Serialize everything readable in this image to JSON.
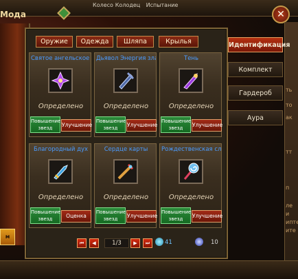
{
  "window": {
    "title": "Мода",
    "close": "✕"
  },
  "top_tabs": [
    "Колесо",
    "Колодец",
    "Испытание"
  ],
  "category_tabs": [
    {
      "label": "Оружие"
    },
    {
      "label": "Одежда"
    },
    {
      "label": "Шляпа"
    },
    {
      "label": "Крылья"
    }
  ],
  "side_menu": [
    {
      "label": "Идентификация",
      "active": true
    },
    {
      "label": "Комплект",
      "active": false
    },
    {
      "label": "Гардероб",
      "active": false
    },
    {
      "label": "Аура",
      "active": false
    }
  ],
  "side_texts": [
    "ть",
    "то",
    "ак",
    "тт",
    "п",
    "ле",
    "и",
    "ипте",
    "ите"
  ],
  "items": [
    {
      "name": "Святое ангельское ор",
      "status": "Определено",
      "btn1": "Повышение звезд",
      "btn2": "Улучшение",
      "icon": "purple-angel-weapon-icon",
      "color": "#b44cf0"
    },
    {
      "name": "Дьявол Энергия зла",
      "status": "Определено",
      "btn1": "Повышение звезд",
      "btn2": "Улучшение",
      "icon": "dark-devil-weapon-icon",
      "color": "#4f6aa8"
    },
    {
      "name": "Тень",
      "status": "Определено",
      "btn1": "Повышение звезд",
      "btn2": "Улучшение",
      "icon": "shadow-weapon-icon",
      "color": "#9a3ae0"
    },
    {
      "name": "Благородный дух",
      "status": "Определено",
      "btn1": "Повышение звезд",
      "btn2": "Оценка",
      "icon": "noble-spirit-weapon-icon",
      "color": "#3aa0e0"
    },
    {
      "name": "Сердце карты",
      "status": "Определено",
      "btn1": "Повышение звезд",
      "btn2": "Улучшение",
      "icon": "card-heart-weapon-icon",
      "color": "#e0a040"
    },
    {
      "name": "Рождественская слад",
      "status": "Определено",
      "btn1": "Повышение звезд",
      "btn2": "Улучшение",
      "icon": "christmas-candy-weapon-icon",
      "color": "#e04060"
    }
  ],
  "pager": {
    "page": "1/3",
    "first": "⏮",
    "prev": "◀",
    "next": "▶",
    "last": "⏭"
  },
  "currencies": {
    "diamonds": "41",
    "orbs": "10"
  },
  "left_button": "м"
}
